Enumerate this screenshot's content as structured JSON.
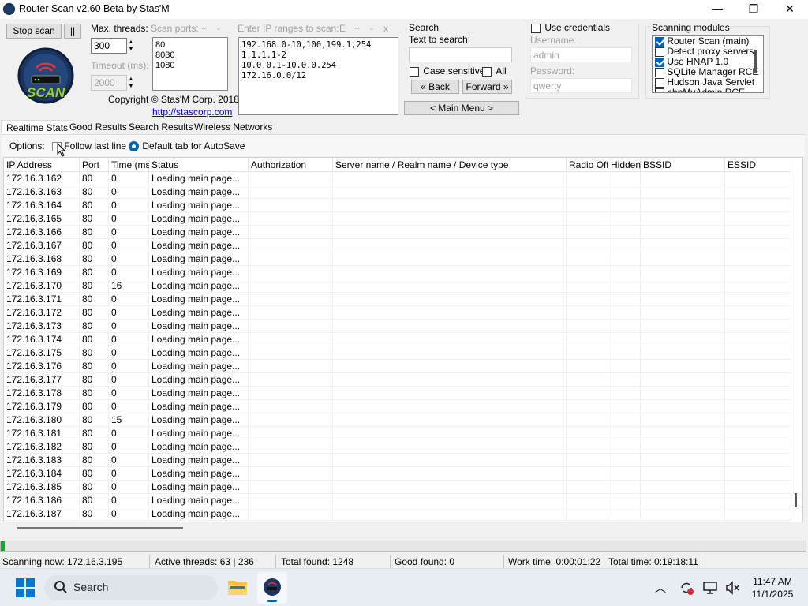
{
  "window": {
    "title": "Router Scan v2.60 Beta by Stas'M",
    "minimize": "—",
    "maximize": "❐",
    "close": "✕"
  },
  "toolbar": {
    "stop_scan": "Stop scan",
    "pause": "||",
    "max_threads_label": "Max. threads:",
    "max_threads_value": "300",
    "timeout_label": "Timeout (ms):",
    "timeout_value": "2000",
    "scan_ports_label": "Scan ports:",
    "ports_add": "+",
    "ports_remove": "-",
    "ports": [
      "80",
      "8080",
      "1080"
    ],
    "ip_ranges_label": "Enter IP ranges to scan:",
    "ip_e": "E",
    "ip_add": "+",
    "ip_remove": "-",
    "ip_clear": "x",
    "ip_ranges": [
      "192.168.0-10,100,199.1,254",
      "1.1.1.1-2",
      "10.0.0.1-10.0.0.254",
      "172.16.0.0/12"
    ],
    "copyright": "Copyright © Stas'M Corp. 2018",
    "link": "http://stascorp.com",
    "logo_text": "SCAN"
  },
  "search": {
    "title": "Search",
    "text_label": "Text to search:",
    "text_value": "",
    "case_sensitive": "Case sensitive",
    "all": "All",
    "back": "« Back",
    "forward": "Forward »",
    "main_menu": "< Main Menu >"
  },
  "credentials": {
    "use_label": "Use credentials",
    "username_label": "Username:",
    "username": "admin",
    "password_label": "Password:",
    "password": "qwerty"
  },
  "modules": {
    "title": "Scanning modules",
    "items": [
      {
        "label": "Router Scan (main)",
        "checked": true
      },
      {
        "label": "Detect proxy servers",
        "checked": false
      },
      {
        "label": "Use HNAP 1.0",
        "checked": true
      },
      {
        "label": "SQLite Manager RCE",
        "checked": false
      },
      {
        "label": "Hudson Java Servlet",
        "checked": false
      },
      {
        "label": "phpMyAdmin RCE",
        "checked": false
      }
    ]
  },
  "tabs": [
    "Realtime Stats",
    "Good Results",
    "Search Results",
    "Wireless Networks"
  ],
  "options": {
    "label": "Options:",
    "follow_last_line": "Follow last line",
    "default_tab": "Default tab for AutoSave"
  },
  "table": {
    "columns": [
      "IP Address",
      "Port",
      "Time (ms)",
      "Status",
      "Authorization",
      "Server name / Realm name / Device type",
      "Radio Off",
      "Hidden",
      "BSSID",
      "ESSID"
    ],
    "rows": [
      [
        "172.16.3.162",
        "80",
        "0",
        "Loading main page..."
      ],
      [
        "172.16.3.163",
        "80",
        "0",
        "Loading main page..."
      ],
      [
        "172.16.3.164",
        "80",
        "0",
        "Loading main page..."
      ],
      [
        "172.16.3.165",
        "80",
        "0",
        "Loading main page..."
      ],
      [
        "172.16.3.166",
        "80",
        "0",
        "Loading main page..."
      ],
      [
        "172.16.3.167",
        "80",
        "0",
        "Loading main page..."
      ],
      [
        "172.16.3.168",
        "80",
        "0",
        "Loading main page..."
      ],
      [
        "172.16.3.169",
        "80",
        "0",
        "Loading main page..."
      ],
      [
        "172.16.3.170",
        "80",
        "16",
        "Loading main page..."
      ],
      [
        "172.16.3.171",
        "80",
        "0",
        "Loading main page..."
      ],
      [
        "172.16.3.172",
        "80",
        "0",
        "Loading main page..."
      ],
      [
        "172.16.3.173",
        "80",
        "0",
        "Loading main page..."
      ],
      [
        "172.16.3.174",
        "80",
        "0",
        "Loading main page..."
      ],
      [
        "172.16.3.175",
        "80",
        "0",
        "Loading main page..."
      ],
      [
        "172.16.3.176",
        "80",
        "0",
        "Loading main page..."
      ],
      [
        "172.16.3.177",
        "80",
        "0",
        "Loading main page..."
      ],
      [
        "172.16.3.178",
        "80",
        "0",
        "Loading main page..."
      ],
      [
        "172.16.3.179",
        "80",
        "0",
        "Loading main page..."
      ],
      [
        "172.16.3.180",
        "80",
        "15",
        "Loading main page..."
      ],
      [
        "172.16.3.181",
        "80",
        "0",
        "Loading main page..."
      ],
      [
        "172.16.3.182",
        "80",
        "0",
        "Loading main page..."
      ],
      [
        "172.16.3.183",
        "80",
        "0",
        "Loading main page..."
      ],
      [
        "172.16.3.184",
        "80",
        "0",
        "Loading main page..."
      ],
      [
        "172.16.3.185",
        "80",
        "0",
        "Loading main page..."
      ],
      [
        "172.16.3.186",
        "80",
        "0",
        "Loading main page..."
      ],
      [
        "172.16.3.187",
        "80",
        "0",
        "Loading main page..."
      ]
    ]
  },
  "status": {
    "scanning_now": "Scanning now: 172.16.3.195",
    "active_threads": "Active threads: 63 | 236",
    "total_found": "Total found: 1248",
    "good_found": "Good found: 0",
    "work_time": "Work time: 0:00:01:22",
    "total_time": "Total time: 0:19:18:11"
  },
  "taskbar": {
    "search_placeholder": "Search",
    "time": "11:47 AM",
    "date": "11/1/2025"
  },
  "colors": {
    "accent": "#0063b1",
    "link": "#0000ee",
    "logo_green": "#9acd32"
  }
}
